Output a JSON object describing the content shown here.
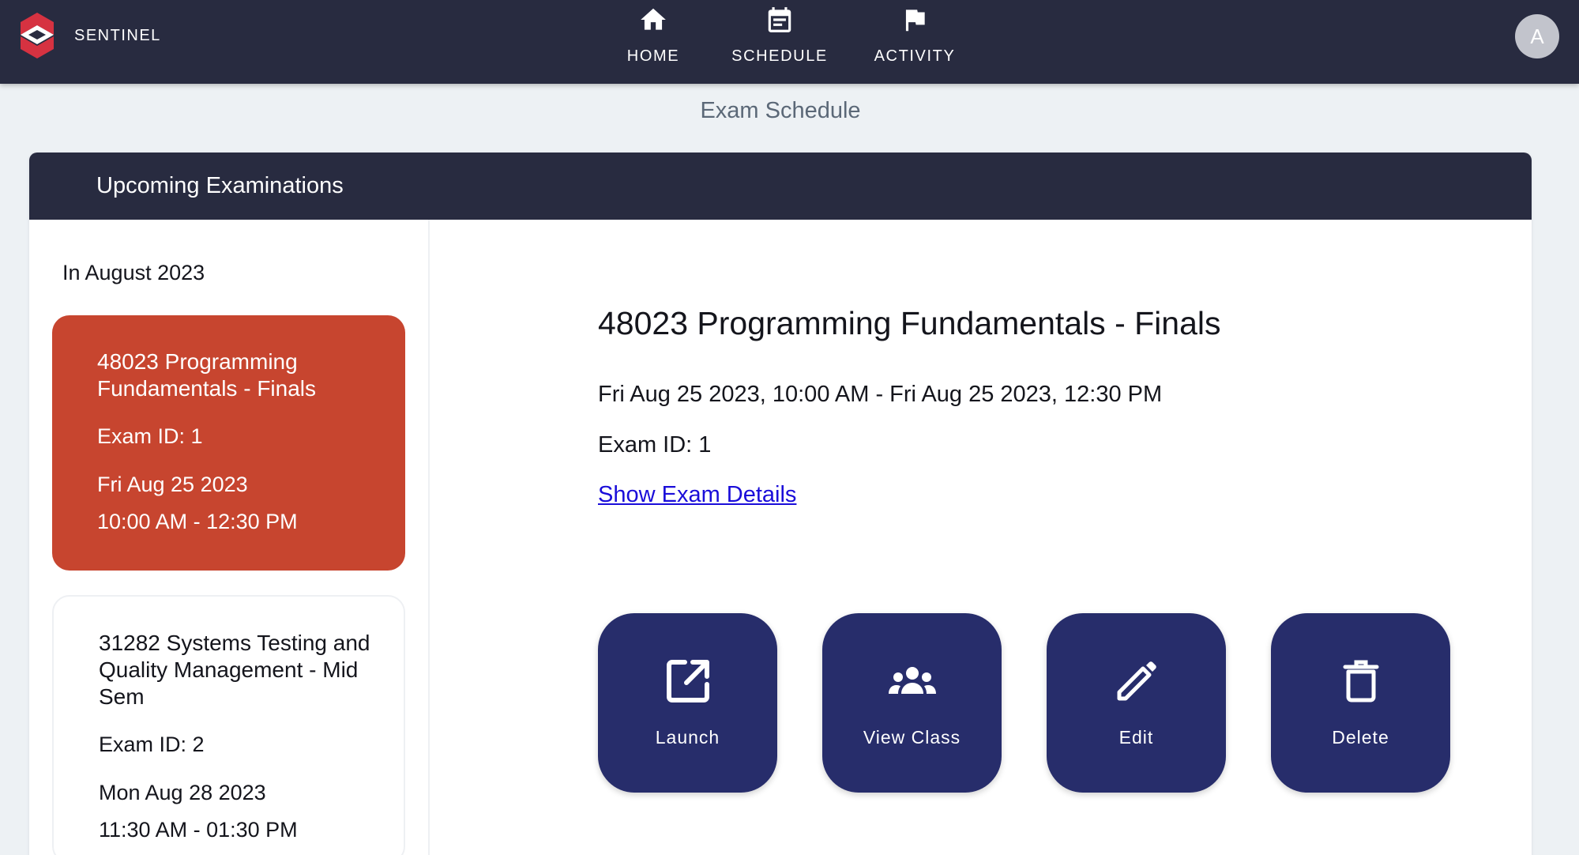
{
  "app": {
    "brand_name": "SENTINEL",
    "avatar_initial": "A"
  },
  "nav": {
    "items": [
      {
        "label": "HOME",
        "icon": "home-icon"
      },
      {
        "label": "SCHEDULE",
        "icon": "calendar-icon"
      },
      {
        "label": "ACTIVITY",
        "icon": "flag-icon"
      }
    ]
  },
  "page": {
    "title": "Exam Schedule"
  },
  "card": {
    "header": "Upcoming Examinations",
    "month_heading": "In August 2023",
    "exams": [
      {
        "title": "48023 Programming Fundamentals - Finals",
        "id_text": "Exam ID: 1",
        "date": "Fri Aug 25 2023",
        "time": "10:00 AM - 12:30 PM",
        "selected": true
      },
      {
        "title": "31282 Systems Testing and Quality Management - Mid Sem",
        "id_text": "Exam ID: 2",
        "date": "Mon Aug 28 2023",
        "time": "11:30 AM - 01:30 PM",
        "selected": false
      }
    ]
  },
  "detail": {
    "title": "48023 Programming Fundamentals - Finals",
    "range": "Fri Aug 25 2023, 10:00 AM - Fri Aug 25 2023, 12:30 PM",
    "id_text": "Exam ID: 1",
    "link_text": "Show Exam Details",
    "actions": [
      {
        "label": "Launch",
        "icon": "external-link-icon"
      },
      {
        "label": "View Class",
        "icon": "group-icon"
      },
      {
        "label": "Edit",
        "icon": "pencil-icon"
      },
      {
        "label": "Delete",
        "icon": "trash-icon"
      }
    ]
  },
  "colors": {
    "topbar": "#282b40",
    "background": "#edf1f4",
    "selected_card": "#c7452f",
    "action_button": "#272d6b",
    "link": "#1a0dd9"
  }
}
